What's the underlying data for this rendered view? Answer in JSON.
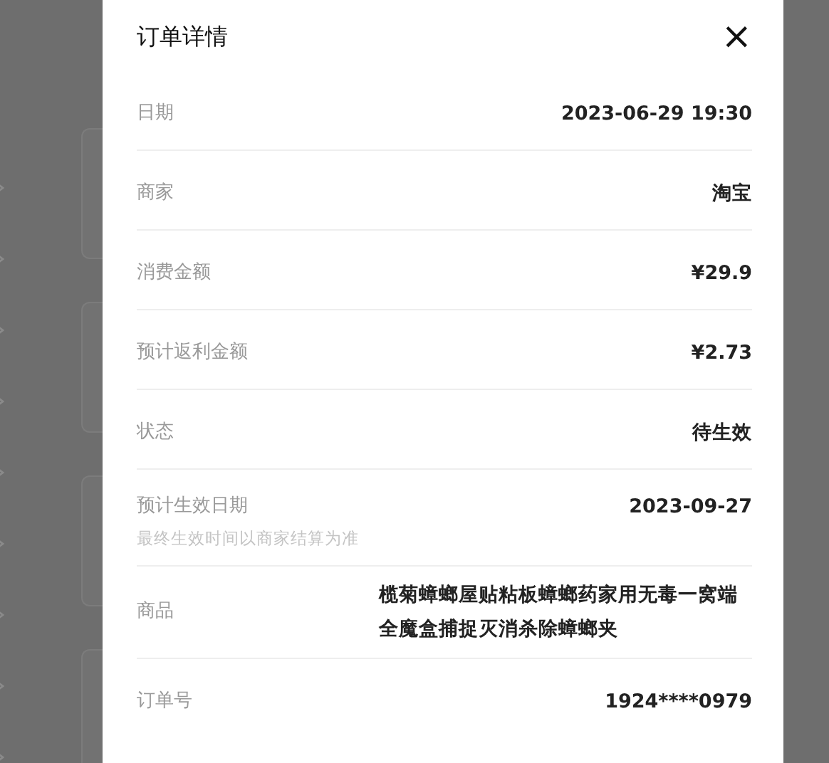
{
  "dialog": {
    "title": "订单详情",
    "close": "×"
  },
  "rows": [
    {
      "label": "日期",
      "value": "2023-06-29 19:30"
    },
    {
      "label": "商家",
      "value": "淘宝"
    },
    {
      "label": "消费金额",
      "value": "¥29.9"
    },
    {
      "label": "预计返利金额",
      "value": "¥2.73"
    },
    {
      "label": "状态",
      "value": "待生效"
    },
    {
      "label": "预计生效日期",
      "note": "最终生效时间以商家结算为准",
      "value": "2023-09-27"
    },
    {
      "label": "商品",
      "value": "榄菊蟑螂屋贴粘板蟑螂药家用无毒一窝端全魔盒捕捉灭消杀除蟑螂夹"
    },
    {
      "label": "订单号",
      "value": "1924****0979"
    }
  ]
}
